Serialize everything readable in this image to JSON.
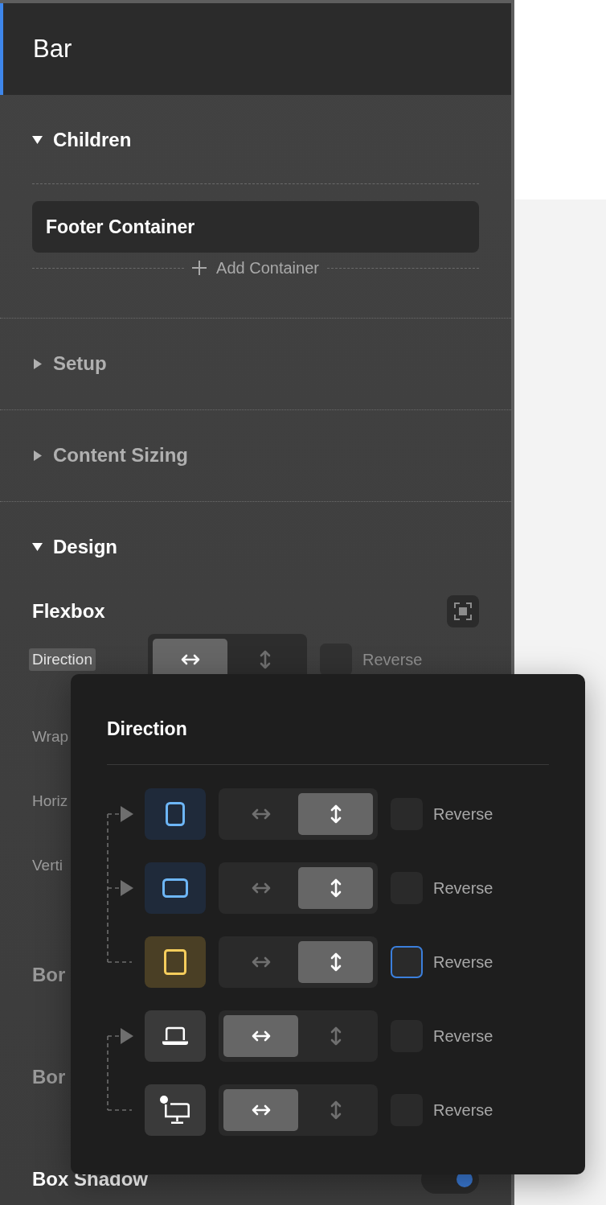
{
  "panel": {
    "title": "Bar"
  },
  "sections": [
    {
      "kind": "children",
      "title": "Children",
      "expanded": true,
      "items": [
        {
          "label": "Footer Container"
        }
      ],
      "add_label": "Add Container"
    },
    {
      "kind": "plain",
      "title": "Setup",
      "expanded": false
    },
    {
      "kind": "plain",
      "title": "Content Sizing",
      "expanded": false
    },
    {
      "kind": "design",
      "title": "Design",
      "expanded": true,
      "group": {
        "title": "Flexbox"
      },
      "items": [
        {
          "kind": "segmented",
          "label": "Direction",
          "highlighted": true,
          "options": [
            {
              "kind": "horizontal",
              "selected": true
            },
            {
              "kind": "vertical",
              "selected": false
            }
          ],
          "reverse": {
            "label": "Reverse",
            "checked": false
          }
        },
        {
          "kind": "field",
          "label": "Wrap",
          "highlighted": false
        },
        {
          "kind": "field",
          "label": "Horiz",
          "highlighted": false
        },
        {
          "kind": "field",
          "label": "Verti",
          "highlighted": false
        },
        {
          "kind": "heading",
          "label": "Bor",
          "muted": true
        },
        {
          "kind": "heading",
          "label": "Bor",
          "muted": true
        },
        {
          "kind": "toggle",
          "label": "Box Shadow",
          "muted": false,
          "on": true
        }
      ]
    }
  ],
  "popover": {
    "title": "Direction",
    "rows": [
      {
        "kind": "phone",
        "selected": false,
        "synced": true,
        "inherits": true,
        "options": [
          {
            "kind": "horizontal",
            "selected": false
          },
          {
            "kind": "vertical",
            "selected": true
          }
        ],
        "reverse": {
          "label": "Reverse",
          "checked": false,
          "focused": false
        }
      },
      {
        "kind": "tablet",
        "selected": false,
        "synced": true,
        "inherits": true,
        "options": [
          {
            "kind": "horizontal",
            "selected": false
          },
          {
            "kind": "vertical",
            "selected": true
          }
        ],
        "reverse": {
          "label": "Reverse",
          "checked": false,
          "focused": false
        }
      },
      {
        "kind": "square",
        "selected": true,
        "synced": false,
        "inherits": false,
        "options": [
          {
            "kind": "horizontal",
            "selected": false
          },
          {
            "kind": "vertical",
            "selected": true
          }
        ],
        "reverse": {
          "label": "Reverse",
          "checked": false,
          "focused": true
        }
      },
      {
        "kind": "laptop",
        "selected": false,
        "synced": false,
        "inherits": true,
        "options": [
          {
            "kind": "horizontal",
            "selected": true
          },
          {
            "kind": "vertical",
            "selected": false
          }
        ],
        "reverse": {
          "label": "Reverse",
          "checked": false,
          "focused": false
        }
      },
      {
        "kind": "desktop",
        "selected": false,
        "synced": false,
        "inherits": false,
        "options": [
          {
            "kind": "horizontal",
            "selected": true
          },
          {
            "kind": "vertical",
            "selected": false
          }
        ],
        "reverse": {
          "label": "Reverse",
          "checked": false,
          "focused": false
        }
      }
    ]
  }
}
